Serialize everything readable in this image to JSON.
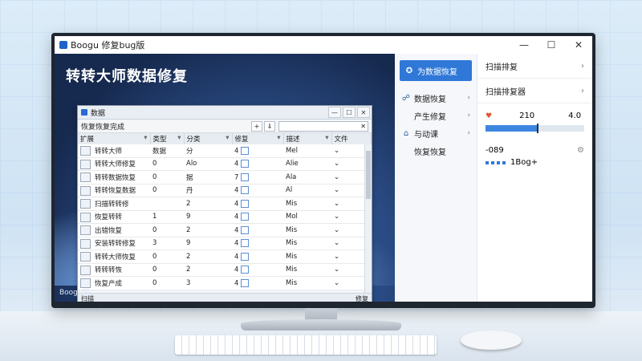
{
  "window": {
    "title": "Boogu 修复bug版",
    "controls": [
      "—",
      "☐",
      "✕"
    ]
  },
  "hero": {
    "title": "转转大师数据修复",
    "footer": "Boogu网"
  },
  "inner_window": {
    "title": "数据",
    "controls": [
      "—",
      "☐",
      "✕"
    ],
    "toolbar_label": "恢复恢复完成",
    "toolbar_btns": [
      "+",
      "⇓"
    ],
    "search_close": "✕",
    "columns": [
      "扩展",
      "类型",
      "分类",
      "修复",
      "描述",
      "文件"
    ],
    "rows": [
      {
        "name": "转转大师",
        "c2": "数据",
        "c3": "分",
        "c4": "4",
        "c5": "Mel",
        "icon": "app-icon"
      },
      {
        "name": "转转大师修复",
        "c2": "0",
        "c3": "Alo",
        "c4": "4",
        "c5": "Alie",
        "icon": "doc-icon"
      },
      {
        "name": "转转数据恢复",
        "c2": "0",
        "c3": "据",
        "c4": "7",
        "c5": "Ala",
        "icon": "red-target-icon"
      },
      {
        "name": "转转恢复数据",
        "c2": "0",
        "c3": "丹",
        "c4": "4",
        "c5": "Al",
        "icon": "green-icon"
      },
      {
        "name": "扫描转转修",
        "c2": "",
        "c3": "2",
        "c4": "4",
        "c5": "Mis",
        "icon": "file-icon"
      },
      {
        "name": "恢复转转",
        "c2": "1",
        "c3": "9",
        "c4": "4",
        "c5": "Mol",
        "icon": "file-icon"
      },
      {
        "name": "出错恢复",
        "c2": "0",
        "c3": "2",
        "c4": "4",
        "c5": "Mis",
        "icon": "drive-icon"
      },
      {
        "name": "安装转转修复",
        "c2": "3",
        "c3": "9",
        "c4": "4",
        "c5": "Mis",
        "icon": "folder-icon"
      },
      {
        "name": "转转大师恢复",
        "c2": "0",
        "c3": "2",
        "c4": "4",
        "c5": "Mis",
        "icon": "doc-icon"
      },
      {
        "name": "转转转恢",
        "c2": "0",
        "c3": "2",
        "c4": "4",
        "c5": "Mis",
        "icon": "photo-icon"
      },
      {
        "name": "恢复产成",
        "c2": "0",
        "c3": "3",
        "c4": "4",
        "c5": "Mis",
        "icon": "file-icon"
      }
    ],
    "status_left": "扫描",
    "status_right": "修复"
  },
  "nav": {
    "active": "为数据恢复",
    "items": [
      "数据恢复",
      "产生修复",
      "与动课",
      "恢复恢复"
    ]
  },
  "right": {
    "items": [
      "扫描排复",
      "扫描排复器"
    ],
    "stat_a": "210",
    "stat_b": "4.0",
    "progress_pct": 52,
    "version": "-089",
    "footer_text": "1Bog+"
  }
}
